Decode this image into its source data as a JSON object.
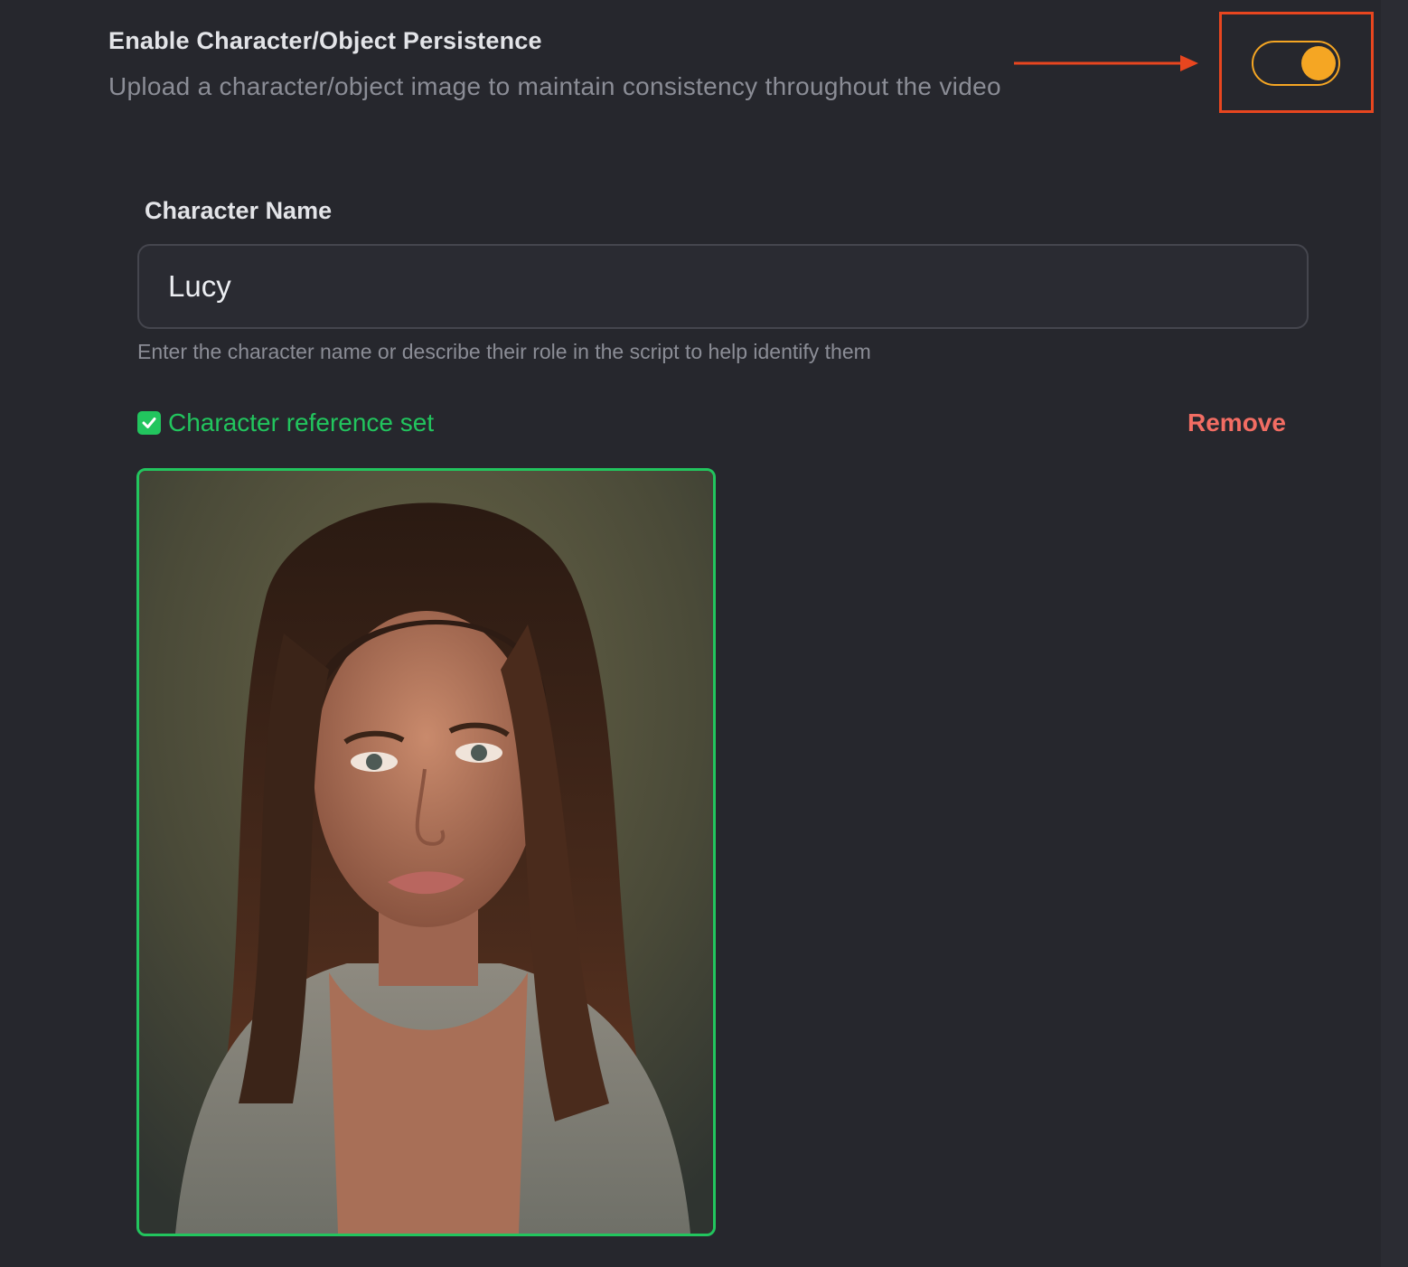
{
  "persistence": {
    "title": "Enable Character/Object Persistence",
    "description": "Upload a character/object image to maintain consistency throughout the video",
    "toggle_on": true
  },
  "character": {
    "label": "Character Name",
    "value": "Lucy",
    "helper": "Enter the character name or describe their role in the script to help identify them"
  },
  "reference": {
    "status": "Character reference set",
    "remove_label": "Remove"
  },
  "colors": {
    "background": "#26272d",
    "accent_toggle": "#f5a623",
    "annotation": "#e8461f",
    "success": "#22c55e",
    "danger": "#f26d63"
  },
  "icons": [
    "check-icon",
    "arrow-annotation"
  ]
}
